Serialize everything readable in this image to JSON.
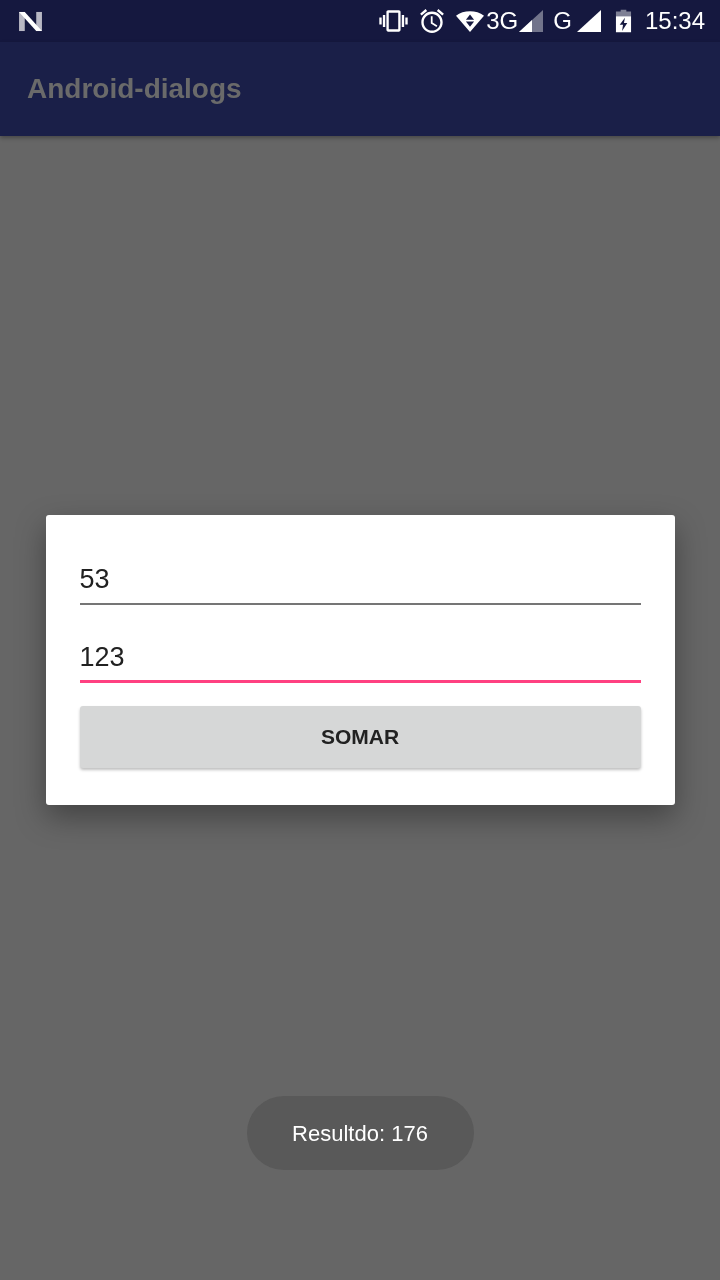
{
  "status_bar": {
    "network_1": "3G",
    "network_2": "G",
    "time": "15:34"
  },
  "app_bar": {
    "title": "Android-dialogs"
  },
  "dialog": {
    "fields": [
      {
        "value": "53",
        "focused": false
      },
      {
        "value": "123",
        "focused": true
      }
    ],
    "button": "SOMAR"
  },
  "toast": {
    "text": "Resultdo: 176"
  }
}
